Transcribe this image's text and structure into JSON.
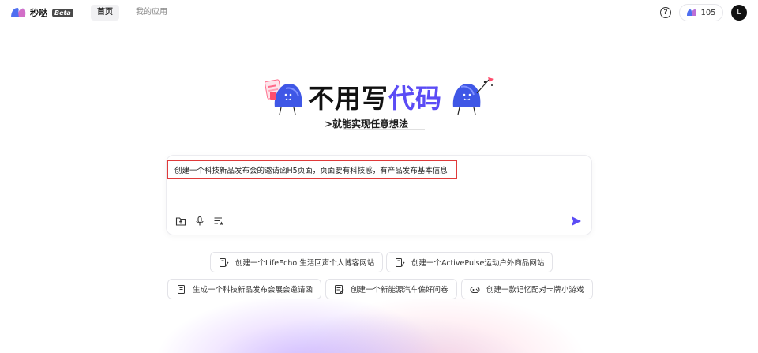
{
  "app": {
    "name": "秒哒",
    "badge": "Beta"
  },
  "nav": {
    "tabs": [
      {
        "label": "首页",
        "active": true
      },
      {
        "label": "我的应用",
        "active": false
      }
    ]
  },
  "header": {
    "help_icon": "question-circle-icon",
    "credits": "105",
    "avatar_initial": "L"
  },
  "hero": {
    "title_main": "不用写",
    "title_accent": "代码",
    "subtitle": ">就能实现任意想法"
  },
  "prompt": {
    "text": "创建一个科技新品发布会的邀请函H5页面，页面要有科技感，有产品发布基本信息",
    "tools": [
      "upload-folder-icon",
      "microphone-icon",
      "list-settings-icon"
    ],
    "send_icon": "send-arrow-icon"
  },
  "suggestions": [
    {
      "label": "创建一个LifeEcho 生活回声个人博客网站",
      "icon": "edit-doc-icon"
    },
    {
      "label": "创建一个ActivePulse运动户外商品网站",
      "icon": "edit-doc-icon"
    },
    {
      "label": "生成一个科技新品发布会展会邀请函",
      "icon": "document-icon"
    },
    {
      "label": "创建一个新能源汽车偏好问卷",
      "icon": "survey-icon"
    },
    {
      "label": "创建一款记忆配对卡牌小游戏",
      "icon": "gamepad-icon"
    }
  ],
  "colors": {
    "accent": "#5b4cf5",
    "highlight_border": "#e03a3a",
    "mascot": "#3f57e6"
  }
}
